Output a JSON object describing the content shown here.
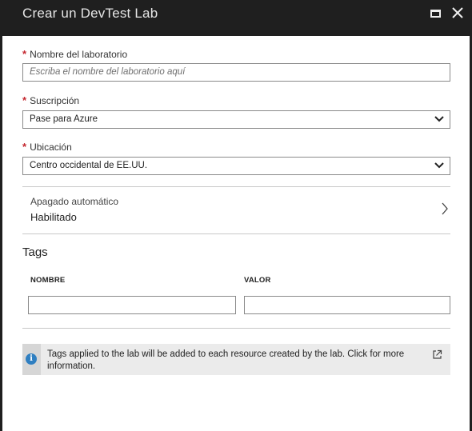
{
  "window": {
    "title": "Crear un DevTest Lab"
  },
  "form": {
    "required_marker": "*",
    "lab_name": {
      "label": "Nombre del laboratorio",
      "placeholder": "Escriba el nombre del laboratorio aquí"
    },
    "subscription": {
      "label": "Suscripción",
      "value": "Pase para Azure"
    },
    "location": {
      "label": "Ubicación",
      "value": "Centro occidental de EE.UU."
    },
    "auto_shutdown": {
      "label": "Apagado automático",
      "value": "Habilitado"
    }
  },
  "tags": {
    "title": "Tags",
    "columns": [
      "NOMBRE",
      "VALOR"
    ],
    "name_value": "",
    "value_value": ""
  },
  "info": {
    "text": "Tags applied to the lab will be added to each resource created by the lab.  Click for more information."
  },
  "colors": {
    "titlebar": "#1f1f1f",
    "required": "#c4262e",
    "info_icon": "#2f7fc1"
  }
}
